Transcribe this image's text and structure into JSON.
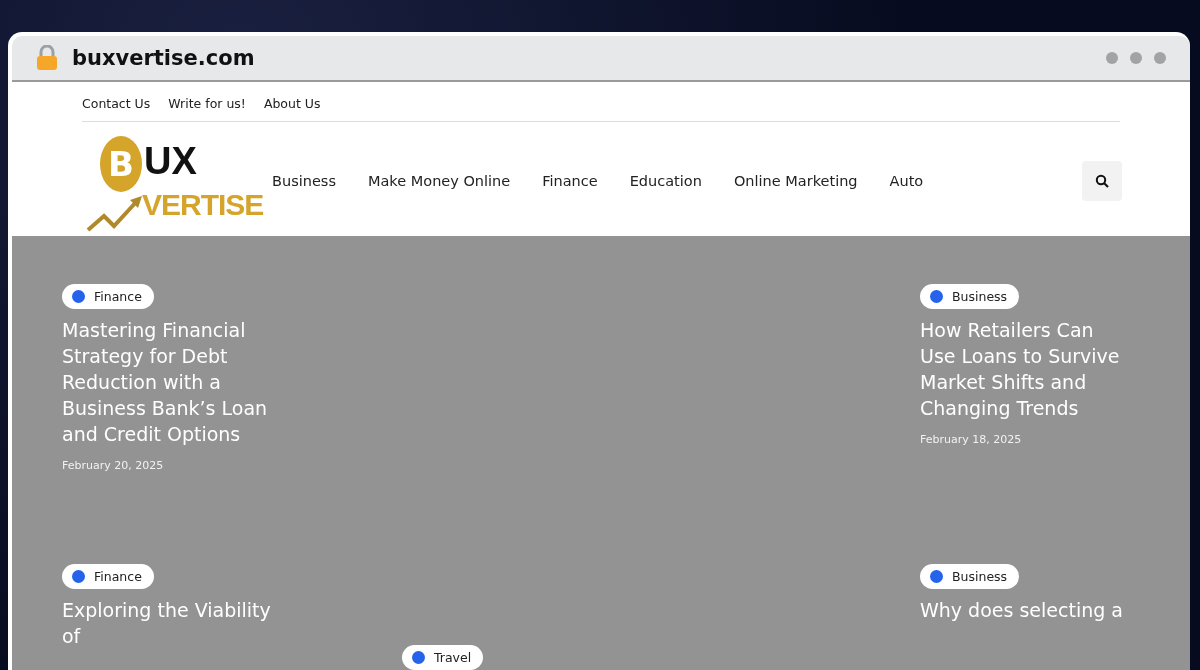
{
  "browser": {
    "url": "buxvertise.com"
  },
  "top_links": [
    "Contact Us",
    "Write for us!",
    "About Us"
  ],
  "logo": {
    "coin": "B",
    "top": "UX",
    "bottom": "VERTISE"
  },
  "nav": [
    "Business",
    "Make Money Online",
    "Finance",
    "Education",
    "Online Marketing",
    "Auto"
  ],
  "rows": [
    {
      "left": {
        "category": "Finance",
        "color": "#2563eb",
        "title": "Mastering Financial Strategy for Debt Reduction with a Business Bank’s Loan and Credit Options",
        "date": "February 20, 2025"
      },
      "right": {
        "category": "Business",
        "color": "#2563eb",
        "title": "How Retailers Can Use Loans to Survive Market Shifts and Changing Trends",
        "date": "February 18, 2025"
      }
    },
    {
      "left": {
        "category": "Finance",
        "color": "#2563eb",
        "title": "Exploring the Viability of"
      },
      "middle": {
        "category": "Travel",
        "color": "#2563eb"
      },
      "right": {
        "category": "Business",
        "color": "#2563eb",
        "title": "Why does selecting a"
      }
    }
  ]
}
